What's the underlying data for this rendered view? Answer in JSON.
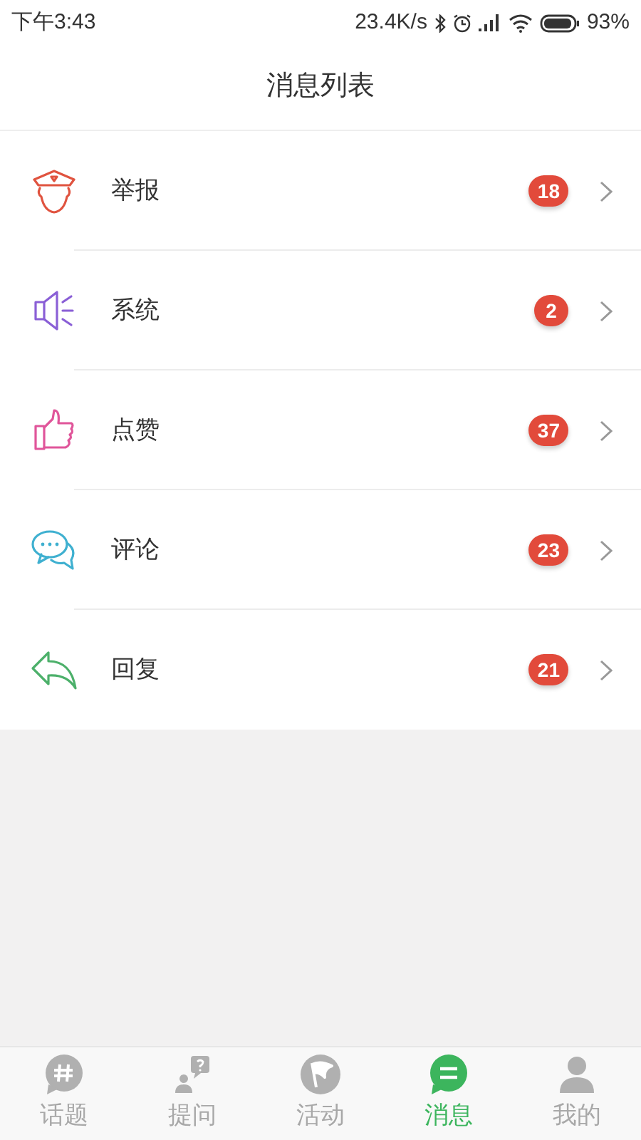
{
  "status_bar": {
    "time": "下午3:43",
    "speed": "23.4K/s",
    "battery": "93%"
  },
  "header": {
    "title": "消息列表"
  },
  "messages": [
    {
      "kind": "police",
      "label": "举报",
      "count": "18",
      "color": "#e0533f"
    },
    {
      "kind": "speaker",
      "label": "系统",
      "count": "2",
      "color": "#8a5fd6"
    },
    {
      "kind": "thumb",
      "label": "点赞",
      "count": "37",
      "color": "#e0559a"
    },
    {
      "kind": "chat",
      "label": "评论",
      "count": "23",
      "color": "#3fb0d0"
    },
    {
      "kind": "reply",
      "label": "回复",
      "count": "21",
      "color": "#4cb06a"
    }
  ],
  "tabs": [
    {
      "kind": "topic",
      "label": "话题",
      "selected": false
    },
    {
      "kind": "question",
      "label": "提问",
      "selected": false
    },
    {
      "kind": "activity",
      "label": "活动",
      "selected": false
    },
    {
      "kind": "message",
      "label": "消息",
      "selected": true
    },
    {
      "kind": "me",
      "label": "我的",
      "selected": false
    }
  ]
}
